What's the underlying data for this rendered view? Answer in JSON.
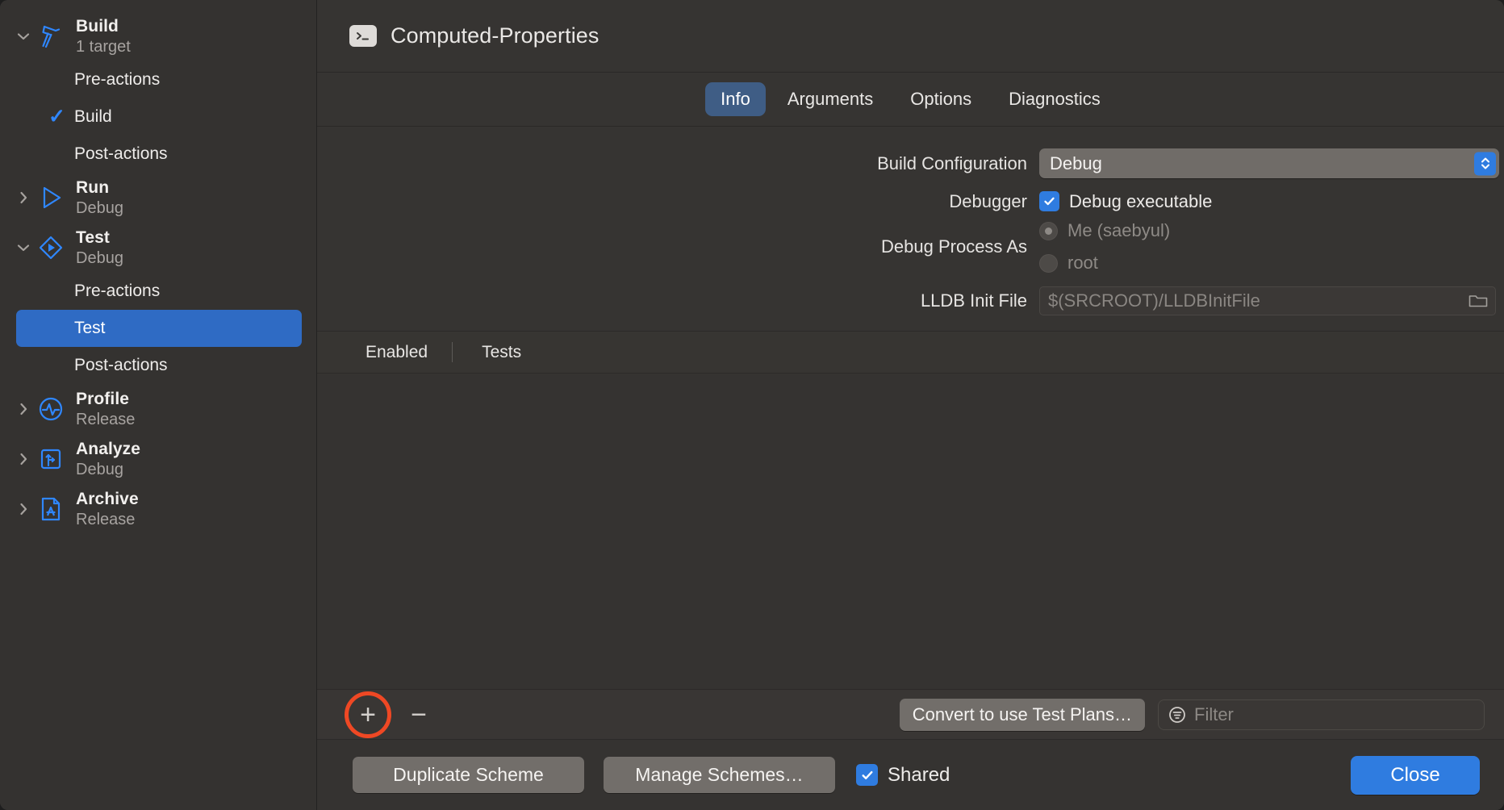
{
  "window": {
    "scheme_title": "Computed-Properties",
    "scheme_icon": "terminal-icon"
  },
  "sidebar": {
    "groups": [
      {
        "name": "Build",
        "title": "Build",
        "subtitle": "1 target",
        "icon": "hammer-icon",
        "expanded": true,
        "disclosure": "chevron-down-icon",
        "children": [
          {
            "label": "Pre-actions",
            "checked": false,
            "selected": false
          },
          {
            "label": "Build",
            "checked": true,
            "selected": false
          },
          {
            "label": "Post-actions",
            "checked": false,
            "selected": false
          }
        ]
      },
      {
        "name": "Run",
        "title": "Run",
        "subtitle": "Debug",
        "icon": "play-triangle-icon",
        "expanded": false,
        "disclosure": "chevron-right-icon",
        "children": []
      },
      {
        "name": "Test",
        "title": "Test",
        "subtitle": "Debug",
        "icon": "diamond-play-icon",
        "expanded": true,
        "disclosure": "chevron-down-icon",
        "children": [
          {
            "label": "Pre-actions",
            "checked": false,
            "selected": false
          },
          {
            "label": "Test",
            "checked": false,
            "selected": true
          },
          {
            "label": "Post-actions",
            "checked": false,
            "selected": false
          }
        ]
      },
      {
        "name": "Profile",
        "title": "Profile",
        "subtitle": "Release",
        "icon": "pulse-circle-icon",
        "expanded": false,
        "disclosure": "chevron-right-icon",
        "children": []
      },
      {
        "name": "Analyze",
        "title": "Analyze",
        "subtitle": "Debug",
        "icon": "analyze-square-icon",
        "expanded": false,
        "disclosure": "chevron-right-icon",
        "children": []
      },
      {
        "name": "Archive",
        "title": "Archive",
        "subtitle": "Release",
        "icon": "archive-document-icon",
        "expanded": false,
        "disclosure": "chevron-right-icon",
        "children": []
      }
    ]
  },
  "tabs": [
    {
      "label": "Info",
      "active": true
    },
    {
      "label": "Arguments",
      "active": false
    },
    {
      "label": "Options",
      "active": false
    },
    {
      "label": "Diagnostics",
      "active": false
    }
  ],
  "form": {
    "build_configuration": {
      "label": "Build Configuration",
      "value": "Debug",
      "stepper_icon": "chevron-up-down-icon"
    },
    "debugger": {
      "label": "Debugger",
      "checkbox_label": "Debug executable",
      "checked": true
    },
    "debug_process_as": {
      "label": "Debug Process As",
      "options": [
        {
          "label": "Me (saebyul)",
          "selected": true,
          "disabled": true
        },
        {
          "label": "root",
          "selected": false,
          "disabled": true
        }
      ]
    },
    "lldb_init_file": {
      "label": "LLDB Init File",
      "value": "",
      "placeholder": "$(SRCROOT)/LLDBInitFile",
      "browse_icon": "folder-icon"
    }
  },
  "tests_table": {
    "columns": [
      "Enabled",
      "Tests"
    ],
    "rows": []
  },
  "list_toolbar": {
    "add_icon": "plus-icon",
    "remove_icon": "minus-icon",
    "add_highlighted": true,
    "convert_button": "Convert to use Test Plans…",
    "filter_icon": "filter-icon",
    "filter_placeholder": "Filter",
    "filter_value": ""
  },
  "bottom_bar": {
    "duplicate_scheme": "Duplicate Scheme",
    "manage_schemes": "Manage Schemes…",
    "shared_label": "Shared",
    "shared_checked": true,
    "close": "Close"
  },
  "colors": {
    "accent_blue": "#2f7ce0",
    "selection_blue": "#2f6bc4",
    "tab_active_blue": "#3f5d85",
    "icon_blue": "#2f87ff",
    "highlight_red": "#ef4824",
    "window_bg": "#353331",
    "sidebar_bg": "#343230"
  }
}
